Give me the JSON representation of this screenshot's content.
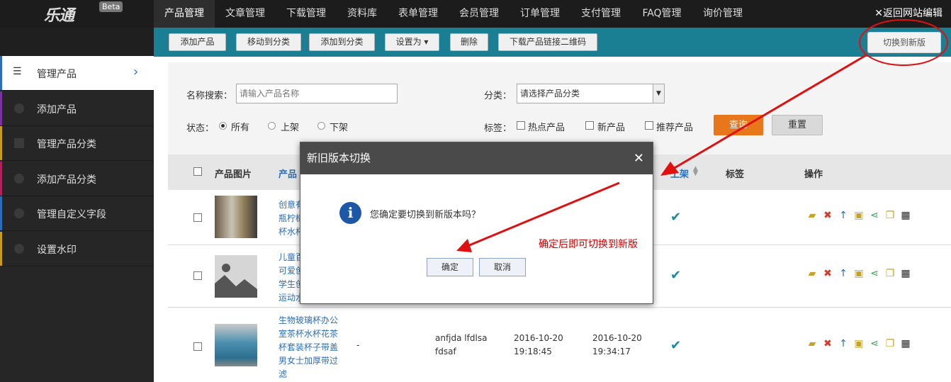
{
  "logo": {
    "text": "乐通",
    "badge": "Beta"
  },
  "nav": {
    "tabs": [
      "产品管理",
      "文章管理",
      "下载管理",
      "资料库",
      "表单管理",
      "会员管理",
      "订单管理",
      "支付管理",
      "FAQ管理",
      "询价管理"
    ],
    "back": "✕返回网站编辑"
  },
  "sidebar": {
    "items": [
      {
        "label": "管理产品",
        "color": "#2a6ebb"
      },
      {
        "label": "添加产品",
        "color": "#7b2fa0"
      },
      {
        "label": "管理产品分类",
        "color": "#c99a1b"
      },
      {
        "label": "添加产品分类",
        "color": "#b0215c"
      },
      {
        "label": "管理自定义字段",
        "color": "#2a6ebb"
      },
      {
        "label": "设置水印",
        "color": "#c99a1b"
      }
    ]
  },
  "toolbar": {
    "buttons": [
      "添加产品",
      "移动到分类",
      "添加到分类",
      "设置为 ▾",
      "删除",
      "下载产品链接二维码"
    ],
    "switch": "切换到新版"
  },
  "search": {
    "name_label": "名称搜索：",
    "name_placeholder": "请输入产品名称",
    "category_label": "分类：",
    "category_value": "请选择产品分类",
    "status_label": "状态：",
    "status_options": [
      "所有",
      "上架",
      "下架"
    ],
    "tag_label": "标签：",
    "tag_options": [
      "热点产品",
      "新产品",
      "推荐产品"
    ],
    "query": "查询",
    "reset": "重置"
  },
  "table": {
    "headers": {
      "image": "产品图片",
      "name": "产品",
      "listed": "上架",
      "tags": "标签",
      "ops": "操作"
    },
    "rows": [
      {
        "name_lines": [
          "创意有",
          "瓶柠檬",
          "杯水杯"
        ],
        "listed": "✔"
      },
      {
        "name_lines": [
          "儿童百",
          "可爱创",
          "学生创",
          "运动水"
        ],
        "listed": "✔"
      },
      {
        "name_lines": [
          "生物玻璃杯办公",
          "室茶杯水杯花茶",
          "杯套装杯子带盖",
          "男女士加厚带过",
          "滤"
        ],
        "dash": "-",
        "user_lines": [
          "anfjda lfdlsa",
          "fdsaf"
        ],
        "created": [
          "2016-10-20",
          "19:18:45"
        ],
        "updated": [
          "2016-10-20",
          "19:34:17"
        ],
        "listed": "✔"
      }
    ]
  },
  "modal": {
    "title": "新旧版本切换",
    "close": "✕",
    "message": "您确定要切换到新版本吗？",
    "ok": "确定",
    "cancel": "取消"
  },
  "annotation": {
    "note": "确定后即可切换到新版"
  }
}
